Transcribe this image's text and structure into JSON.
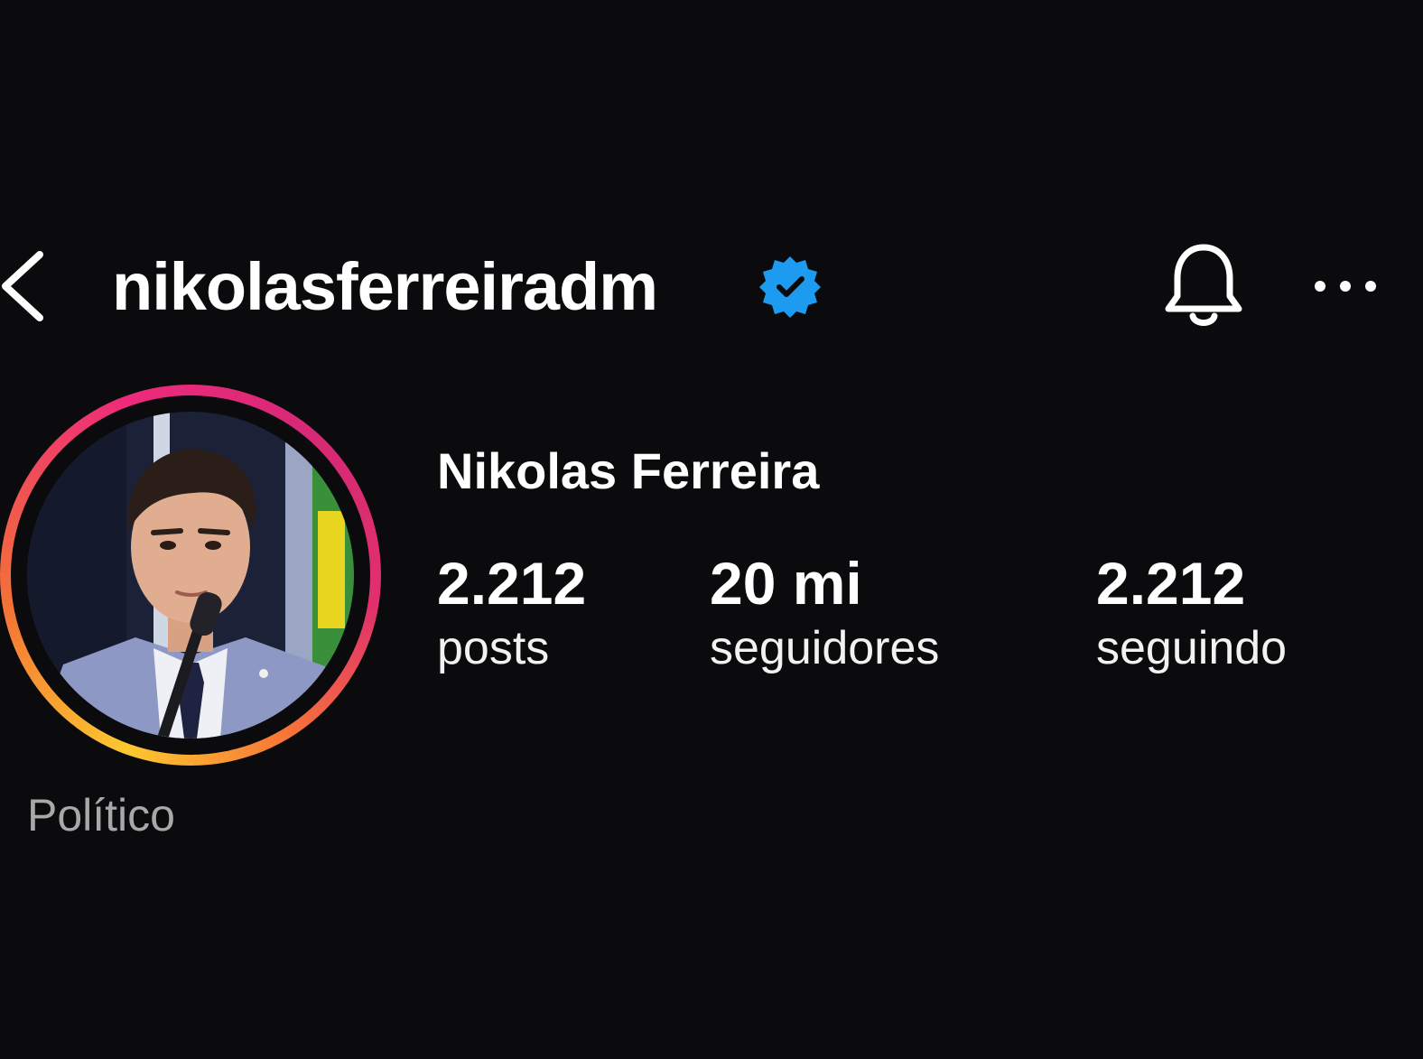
{
  "header": {
    "username": "nikolasferreiradm",
    "back_icon": "chevron-left-icon",
    "verified_icon": "verified-badge-icon",
    "notifications_icon": "bell-icon",
    "more_icon": "more-horizontal-icon"
  },
  "profile": {
    "display_name": "Nikolas Ferreira",
    "category": "Político",
    "stats": [
      {
        "value": "2.212",
        "label": "posts"
      },
      {
        "value": "20 mi",
        "label": "seguidores"
      },
      {
        "value": "2.212",
        "label": "seguindo"
      }
    ]
  },
  "colors": {
    "background": "#0b0b0d",
    "text_primary": "#ffffff",
    "text_secondary": "#a8a8a8",
    "verified_blue": "#1d9bf0",
    "story_ring_gradient": [
      "#fdc830",
      "#f37335",
      "#ee2a7b",
      "#d62976"
    ]
  }
}
